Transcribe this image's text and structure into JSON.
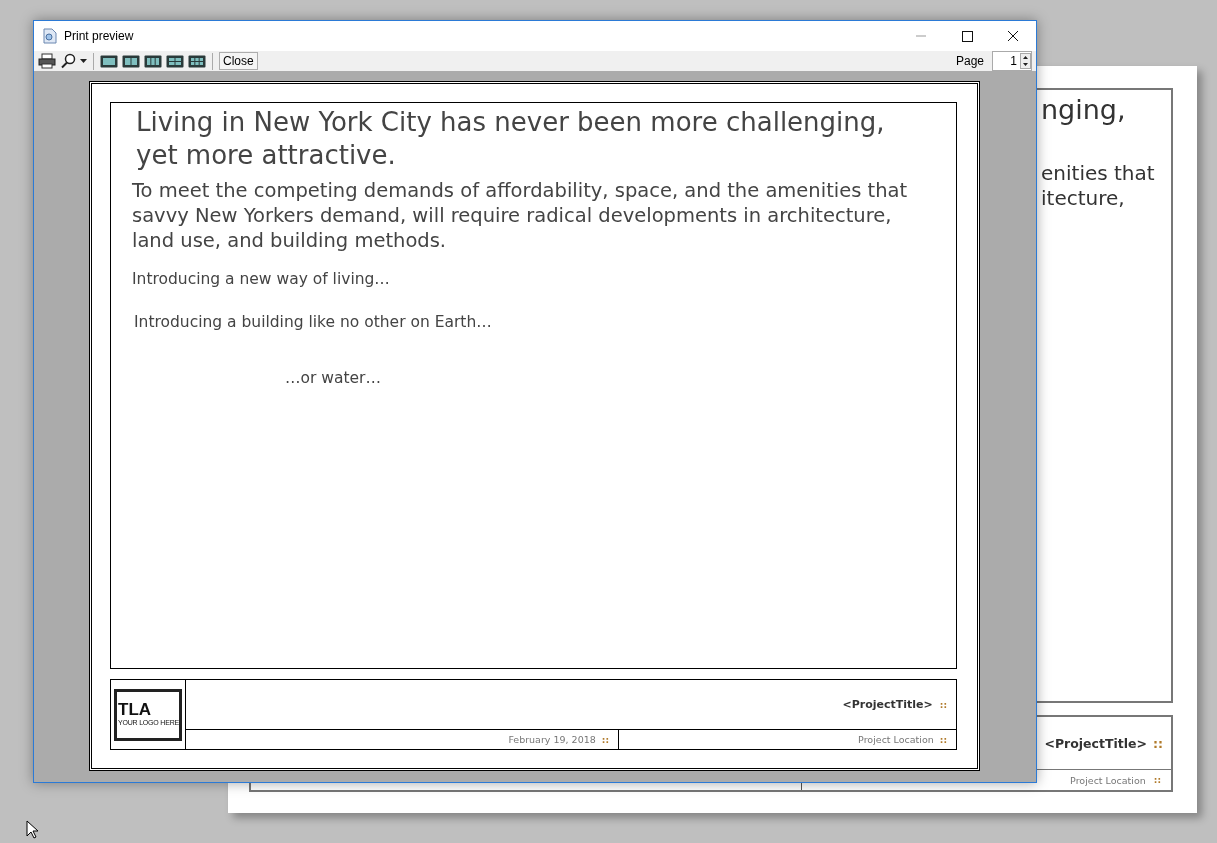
{
  "window": {
    "title": "Print preview"
  },
  "toolbar": {
    "tools": [
      {
        "kind": "print"
      },
      {
        "kind": "zoom"
      },
      {
        "kind": "single"
      },
      {
        "kind": "double"
      },
      {
        "kind": "triple"
      },
      {
        "kind": "quad"
      },
      {
        "kind": "six"
      }
    ],
    "close_label": "Close",
    "page_label": "Page",
    "page_value": "1"
  },
  "document": {
    "heading": "Living in New York City has never been more challenging, yet more attractive.",
    "lead": "To meet the competing demands of affordability, space, and the amenities that savvy New Yorkers demand, will require radical developments in architecture, land use, and building methods.",
    "lines": [
      {
        "text": "Introducing a new way of living…",
        "kind": "plain"
      },
      {
        "text": "Introducing a building like no other on Earth…",
        "kind": "plain"
      },
      {
        "text": "…or water…",
        "kind": "indented"
      }
    ],
    "logo": {
      "text": "TLA",
      "subtext": "YOUR LOGO HERE"
    },
    "project_title": {
      "text": "<ProjectTitle>",
      "mark": "::"
    },
    "date": {
      "text": "February 19, 2018",
      "mark": "::"
    },
    "location": {
      "text": "Project Location",
      "mark": "::"
    }
  },
  "background_page": {
    "heading_fragment": "nging,",
    "lead_fragments": [
      "enities that",
      "itecture,"
    ],
    "project_title": {
      "text": "<ProjectTitle>",
      "mark": "::"
    },
    "location": {
      "text": "Project Location",
      "mark": "::"
    }
  }
}
